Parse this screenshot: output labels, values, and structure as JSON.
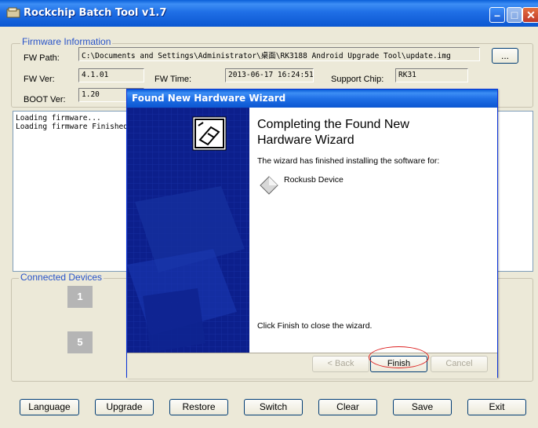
{
  "window": {
    "title": "Rockchip Batch Tool v1.7"
  },
  "titlebar_buttons": {
    "minimize": "–",
    "maximize": "□",
    "close": "✕"
  },
  "firmware": {
    "group_label": "Firmware Information",
    "fw_path_label": "FW Path:",
    "fw_path_value": "C:\\Documents and Settings\\Administrator\\桌面\\RK3188 Android Upgrade Tool\\update.img",
    "browse_label": "...",
    "fw_ver_label": "FW Ver:",
    "fw_ver_value": "4.1.01",
    "fw_time_label": "FW Time:",
    "fw_time_value": "2013-06-17 16:24:51",
    "support_chip_label": "Support Chip:",
    "support_chip_value": "RK31",
    "boot_ver_label": "BOOT Ver:",
    "boot_ver_value": "1.20"
  },
  "log": {
    "lines": [
      "Loading firmware...",
      "Loading firmware Finished"
    ]
  },
  "devices": {
    "group_label": "Connected Devices",
    "slots": [
      "1",
      "5"
    ]
  },
  "buttons": {
    "language": "Language",
    "upgrade": "Upgrade",
    "restore": "Restore",
    "switch": "Switch",
    "clear": "Clear",
    "save": "Save",
    "exit": "Exit"
  },
  "wizard": {
    "title": "Found New Hardware Wizard",
    "heading": "Completing the Found New Hardware Wizard",
    "message": "The wizard has finished installing the software for:",
    "device": "Rockusb Device",
    "finish_hint": "Click Finish to close the wizard.",
    "back_label": "< Back",
    "finish_label": "Finish",
    "cancel_label": "Cancel"
  },
  "colors": {
    "accent": "#0c57d1",
    "highlight_circle": "#dd2222"
  }
}
